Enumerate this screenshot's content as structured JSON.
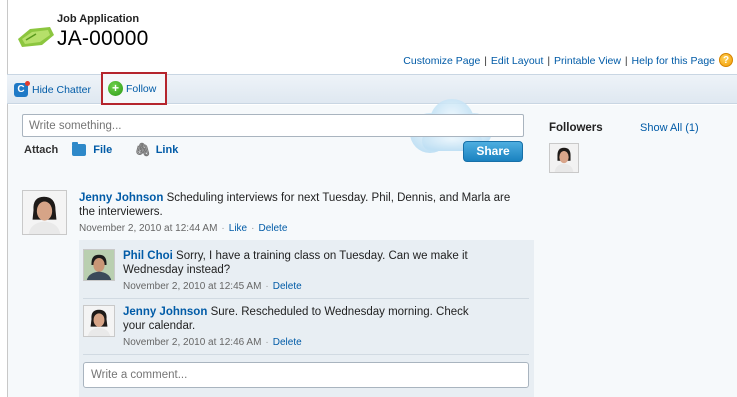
{
  "header": {
    "record_type": "Job Application",
    "record_name": "JA-00000",
    "links": [
      "Customize Page",
      "Edit Layout",
      "Printable View",
      "Help for this Page"
    ],
    "separator": "|"
  },
  "chatter_bar": {
    "hide_label": "Hide Chatter",
    "follow_label": "Follow"
  },
  "publisher": {
    "placeholder": "Write something...",
    "attach_label": "Attach",
    "file_label": "File",
    "link_label": "Link",
    "share_label": "Share"
  },
  "followers": {
    "title": "Followers",
    "show_all": "Show All (1)"
  },
  "post": {
    "author": "Jenny Johnson",
    "text": "Scheduling interviews for next Tuesday. Phil, Dennis, and Marla are the interviewers.",
    "timestamp": "November 2, 2010 at 12:44 AM",
    "like_label": "Like",
    "delete_label": "Delete",
    "dot": "·"
  },
  "comments": [
    {
      "author": "Phil Choi",
      "text": "Sorry, I have a training class on Tuesday. Can we make it Wednesday instead?",
      "timestamp": "November 2, 2010 at 12:45 AM",
      "delete_label": "Delete"
    },
    {
      "author": "Jenny Johnson",
      "text": "Sure. Rescheduled to Wednesday morning. Check your calendar.",
      "timestamp": "November 2, 2010 at 12:46 AM",
      "delete_label": "Delete"
    }
  ],
  "comment_box": {
    "placeholder": "Write a comment..."
  },
  "colors": {
    "link": "#015ba7",
    "highlight_border": "#b5252d",
    "share_button": "#1a82c0"
  },
  "icons": [
    "job-application-icon",
    "chatter-icon",
    "plus-icon",
    "help-icon",
    "file-icon",
    "link-icon",
    "cloud-icon"
  ]
}
